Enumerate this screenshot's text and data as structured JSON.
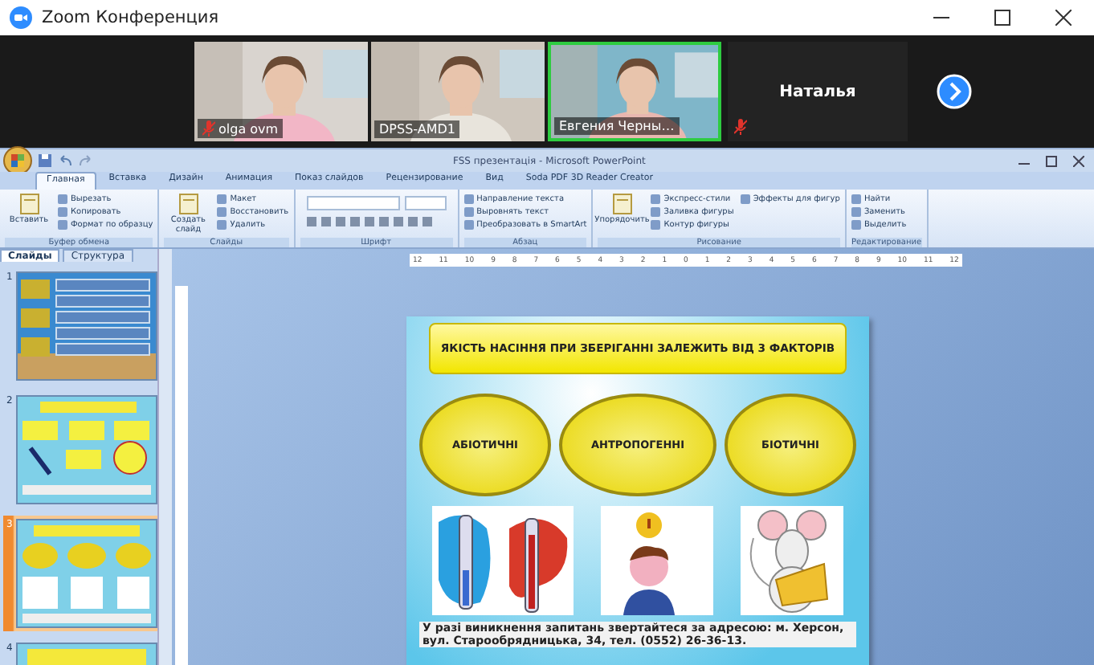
{
  "window": {
    "title": "Zoom Конференция"
  },
  "participants": [
    {
      "name": "olga ovm",
      "muted": true,
      "speaking": false
    },
    {
      "name": "DPSS-AMD1",
      "muted": false,
      "speaking": false
    },
    {
      "name": "Евгения Черны…",
      "muted": false,
      "speaking": true
    },
    {
      "name": "Наталья",
      "muted": true
    }
  ],
  "powerpoint": {
    "title": "FSS презентація - Microsoft PowerPoint",
    "tabs": [
      {
        "label": "Главная",
        "selected": true
      },
      {
        "label": "Вставка",
        "selected": false
      },
      {
        "label": "Дизайн",
        "selected": false
      },
      {
        "label": "Анимация",
        "selected": false
      },
      {
        "label": "Показ слайдов",
        "selected": false
      },
      {
        "label": "Рецензирование",
        "selected": false
      },
      {
        "label": "Вид",
        "selected": false
      },
      {
        "label": "Soda PDF 3D Reader Creator",
        "selected": false
      }
    ],
    "groups": [
      {
        "label": "Буфер обмена",
        "big": "Вставить",
        "items": [
          "Вырезать",
          "Копировать",
          "Формат по образцу"
        ]
      },
      {
        "label": "Слайды",
        "big": "Создать слайд",
        "items": [
          "Макет",
          "Восстановить",
          "Удалить"
        ]
      },
      {
        "label": "Шрифт",
        "kind": "font"
      },
      {
        "label": "Абзац",
        "items": [
          "Направление текста",
          "Выровнять текст",
          "Преобразовать в SmartArt"
        ]
      },
      {
        "label": "Рисование",
        "big": "Упорядочить",
        "items": [
          "Экспресс-стили",
          "Заливка фигуры",
          "Контур фигуры",
          "Эффекты для фигур"
        ]
      },
      {
        "label": "Редактирование",
        "items": [
          "Найти",
          "Заменить",
          "Выделить"
        ]
      }
    ],
    "panel_tabs": [
      {
        "label": "Слайды",
        "selected": true
      },
      {
        "label": "Структура",
        "selected": false
      }
    ],
    "thumbnails": [
      {
        "number": "1",
        "selected": false,
        "kind": "harvest"
      },
      {
        "number": "2",
        "selected": false,
        "kind": "scheme"
      },
      {
        "number": "3",
        "selected": true,
        "kind": "factors"
      },
      {
        "number": "4",
        "selected": false,
        "kind": "photos"
      }
    ],
    "ruler": [
      "12",
      "11",
      "10",
      "9",
      "8",
      "7",
      "6",
      "5",
      "4",
      "3",
      "2",
      "1",
      "0",
      "1",
      "2",
      "3",
      "4",
      "5",
      "6",
      "7",
      "8",
      "9",
      "10",
      "11",
      "12"
    ],
    "slide": {
      "heading": "ЯКІСТЬ НАСІННЯ ПРИ ЗБЕРІГАННІ ЗАЛЕЖИТЬ ВІД 3 ФАКТОРІВ",
      "factors": [
        "АБІОТИЧНІ",
        "АНТРОПОГЕННІ",
        "БІОТИЧНІ"
      ],
      "images": [
        {
          "kind": "thermometers"
        },
        {
          "kind": "thinking"
        },
        {
          "kind": "mouse"
        }
      ],
      "footer": "У разі виникнення запитань звертайтеся за адресою: м. Херсон, вул. Старообрядницька, 34, тел. (0552) 26-36-13."
    }
  }
}
